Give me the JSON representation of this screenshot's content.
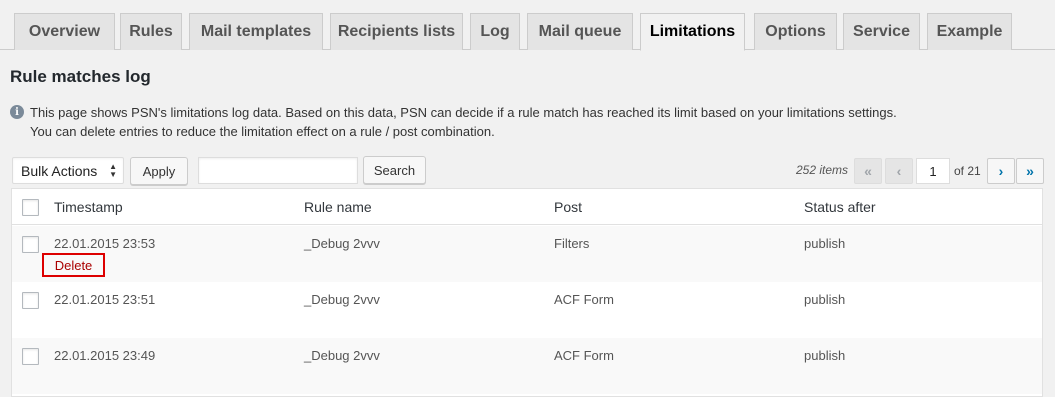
{
  "tabs": [
    {
      "label": "Overview",
      "active": false
    },
    {
      "label": "Rules",
      "active": false
    },
    {
      "label": "Mail templates",
      "active": false
    },
    {
      "label": "Recipients lists",
      "active": false
    },
    {
      "label": "Log",
      "active": false
    },
    {
      "label": "Mail queue",
      "active": false
    },
    {
      "label": "Limitations",
      "active": true
    },
    {
      "label": "Options",
      "active": false
    },
    {
      "label": "Service",
      "active": false
    },
    {
      "label": "Example",
      "active": false
    }
  ],
  "page_title": "Rule matches log",
  "info": {
    "icon": "info-icon",
    "line1": "This page shows PSN's limitations log data. Based on this data, PSN can decide if a rule match has reached its limit based on your limitations settings.",
    "line2": "You can delete entries to reduce the limitation effect on a rule / post combination."
  },
  "toolbar": {
    "bulk_actions": "Bulk Actions",
    "apply": "Apply",
    "search_value": "",
    "search_button": "Search"
  },
  "pagination": {
    "items": "252 items",
    "first": "«",
    "prev": "‹",
    "current_page": "1",
    "of_total": "of 21",
    "next": "›",
    "last": "»"
  },
  "table": {
    "columns": [
      "Timestamp",
      "Rule name",
      "Post",
      "Status after"
    ],
    "rows": [
      {
        "timestamp": "22.01.2015 23:53",
        "rule": "_Debug 2vvv",
        "post": "Filters",
        "status": "publish",
        "action": "Delete"
      },
      {
        "timestamp": "22.01.2015 23:51",
        "rule": "_Debug 2vvv",
        "post": "ACF Form",
        "status": "publish"
      },
      {
        "timestamp": "22.01.2015 23:49",
        "rule": "_Debug 2vvv",
        "post": "ACF Form",
        "status": "publish"
      }
    ]
  },
  "colors": {
    "accent": "#0073aa",
    "delete_highlight": "#dd0000"
  }
}
